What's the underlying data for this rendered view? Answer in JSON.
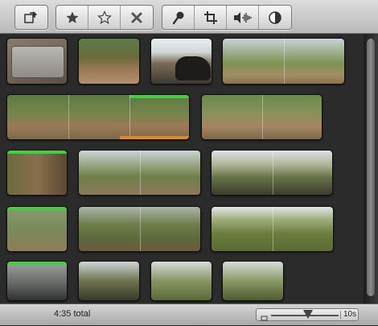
{
  "toolbar": {
    "groups": [
      [
        "import-icon"
      ],
      [
        "favorite-star-icon",
        "unmark-star-icon",
        "reject-x-icon"
      ],
      [
        "voiceover-mic-icon",
        "crop-icon",
        "audio-adjust-icon",
        "color-adjust-icon"
      ]
    ]
  },
  "status": {
    "total": "4:35 total",
    "zoom_value": "10s",
    "zoom_level": 0.55
  },
  "colors": {
    "favorite_bar": "#3fd13f",
    "selection_bar": "#e08a1e",
    "background": "#2b2b2b"
  }
}
